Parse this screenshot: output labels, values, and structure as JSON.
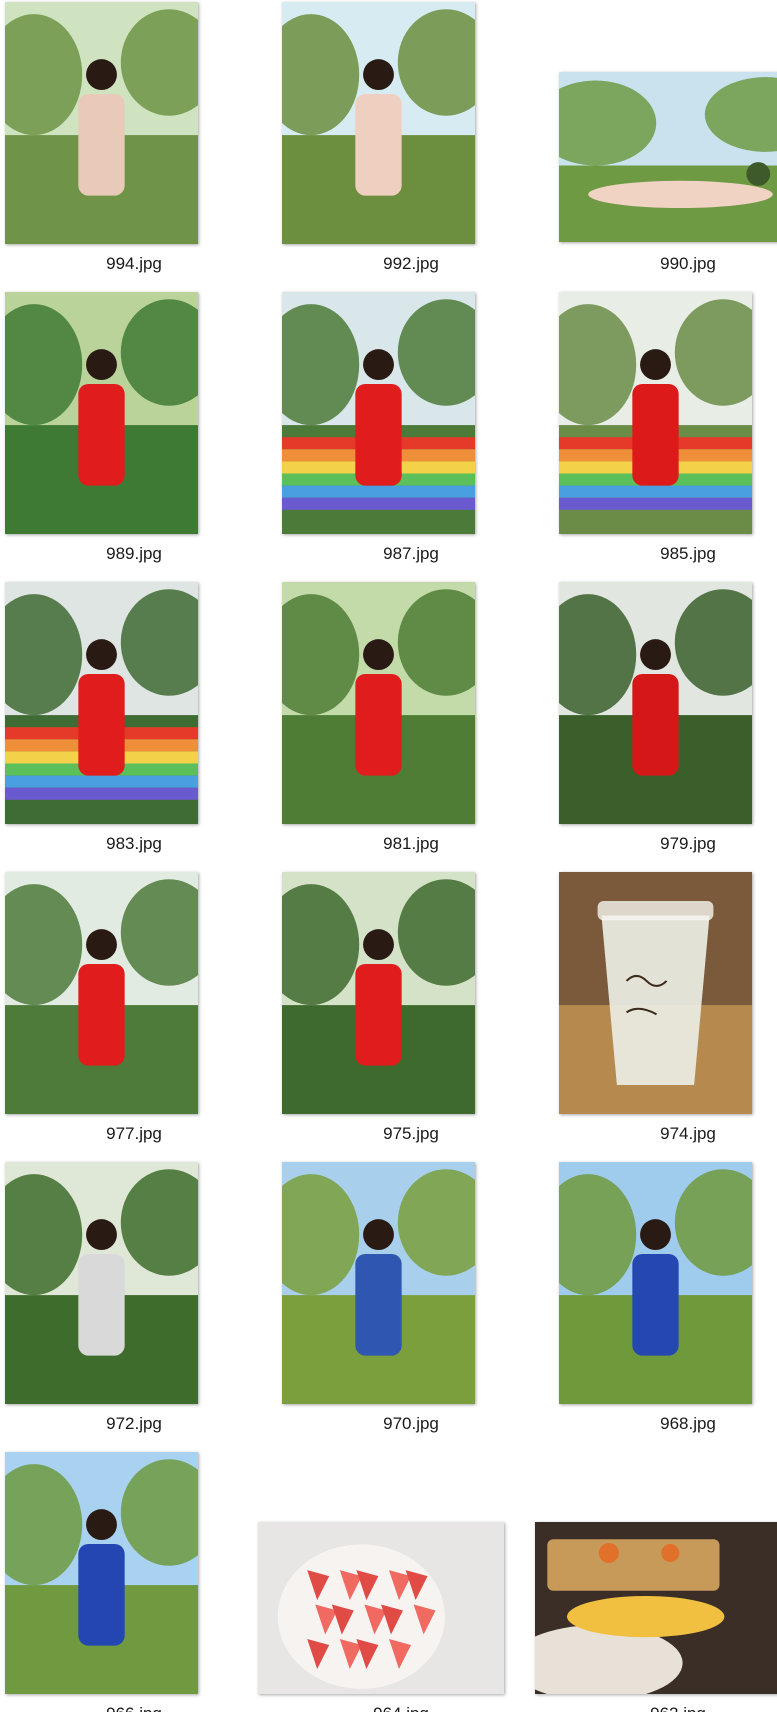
{
  "files": [
    {
      "name": "994.jpg",
      "subject": "woman-pink-dress-tree",
      "palette": [
        "#cfe3c0",
        "#6f9447",
        "#e9c9b8",
        "#5a4a3a"
      ]
    },
    {
      "name": "992.jpg",
      "subject": "woman-sitting-grass",
      "palette": [
        "#d6ecf2",
        "#6b8f3e",
        "#efcfc0",
        "#4d3b2a"
      ]
    },
    {
      "name": "990.jpg",
      "subject": "woman-lying-grass",
      "palette": [
        "#c9e2ee",
        "#6e9a43",
        "#f1d3c4",
        "#3e5a2a"
      ]
    },
    {
      "name": "989.jpg",
      "subject": "woman-red-portrait",
      "palette": [
        "#b9d39b",
        "#3f7a34",
        "#e01c1c",
        "#f0c8a8"
      ]
    },
    {
      "name": "987.jpg",
      "subject": "woman-rainbow-wall",
      "palette": [
        "#d9e7ea",
        "#4c7a39",
        "#e01c1c",
        "#f3b53a"
      ]
    },
    {
      "name": "985.jpg",
      "subject": "woman-red-wall-sky",
      "palette": [
        "#e8ede6",
        "#6a8c46",
        "#dd1a1a",
        "#f08f3a"
      ]
    },
    {
      "name": "983.jpg",
      "subject": "woman-rainbow-wall-wide",
      "palette": [
        "#dfe5e2",
        "#3f6b34",
        "#e01c1c",
        "#4a9fe0"
      ]
    },
    {
      "name": "981.jpg",
      "subject": "woman-stone-bench",
      "palette": [
        "#c3dba9",
        "#4f7d35",
        "#e01c1c",
        "#b7b2a6"
      ]
    },
    {
      "name": "979.jpg",
      "subject": "woman-pavilion",
      "palette": [
        "#e1e6e1",
        "#3a5f2a",
        "#d41818",
        "#6a2a1a"
      ]
    },
    {
      "name": "977.jpg",
      "subject": "woman-forest-path",
      "palette": [
        "#e2ebe2",
        "#4e7a3a",
        "#e01c1c",
        "#cfcabf"
      ]
    },
    {
      "name": "975.jpg",
      "subject": "woman-stone-steps",
      "palette": [
        "#d4e3c8",
        "#3f6a2e",
        "#e01c1c",
        "#d8d6cf"
      ]
    },
    {
      "name": "974.jpg",
      "subject": "iced-drink-cup",
      "palette": [
        "#7a5a3a",
        "#b68a4e",
        "#e9eadf",
        "#3a2a1a"
      ]
    },
    {
      "name": "972.jpg",
      "subject": "man-bamboo-path",
      "palette": [
        "#dfe7d6",
        "#3e6c2c",
        "#d9d9d9",
        "#6a8db0"
      ]
    },
    {
      "name": "970.jpg",
      "subject": "woman-blue-dress-field",
      "palette": [
        "#a8d0ec",
        "#7a9f3c",
        "#2f56b0",
        "#6a5a3a"
      ]
    },
    {
      "name": "968.jpg",
      "subject": "woman-blue-dress-picnic",
      "palette": [
        "#9fcbed",
        "#6e9a3c",
        "#2447b0",
        "#c23a6a"
      ]
    },
    {
      "name": "966.jpg",
      "subject": "woman-blue-dress-closeup",
      "palette": [
        "#a9d2f0",
        "#6f9a3f",
        "#2446b3",
        "#d21c1c"
      ]
    },
    {
      "name": "964.jpg",
      "subject": "watermelon-plate",
      "palette": [
        "#e8e6e4",
        "#f06a62",
        "#e14b45",
        "#f6f3f1"
      ]
    },
    {
      "name": "962.jpg",
      "subject": "food-table",
      "palette": [
        "#3a2e26",
        "#f1c040",
        "#e7e1d8",
        "#e0702a"
      ]
    }
  ]
}
